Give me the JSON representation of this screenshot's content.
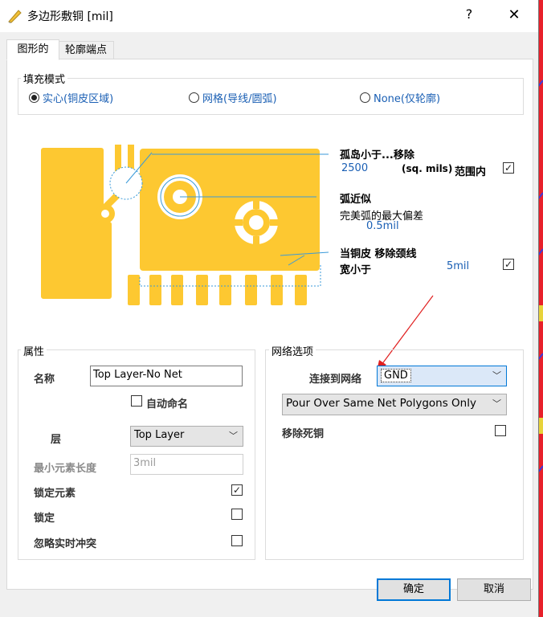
{
  "window": {
    "title": "多边形敷铜 [mil]",
    "help": "?",
    "close": "✕"
  },
  "tabs": [
    {
      "label": "图形的"
    },
    {
      "label": "轮廓端点"
    }
  ],
  "fill_mode": {
    "label": "填充模式",
    "options": [
      {
        "label": "实心(铜皮区域)",
        "selected": true
      },
      {
        "label": "网格(导线/圆弧)",
        "selected": false
      },
      {
        "label": "None(仅轮廓)",
        "selected": false
      }
    ]
  },
  "settings": {
    "island": {
      "label": "孤岛小于...移除",
      "value": "2500",
      "unit": "(sq. mils)",
      "suffix": "范围内",
      "checked": true
    },
    "arc": {
      "label": "弧近似",
      "sub": "完美弧的最大偏差",
      "value": "0.5mil"
    },
    "neck": {
      "label": "当铜皮  移除颈线",
      "label2": "宽小于",
      "value": "5mil",
      "checked": true
    }
  },
  "properties": {
    "label": "属性",
    "name_label": "名称",
    "name_value": "Top Layer-No Net",
    "auto_name_label": "自动命名",
    "auto_name_checked": false,
    "layer_label": "层",
    "layer_value": "Top Layer",
    "min_len_label": "最小元素长度",
    "min_len_placeholder": "3mil",
    "lock_primitives_label": "锁定元素",
    "lock_primitives_checked": true,
    "locked_label": "锁定",
    "locked_checked": false,
    "ignore_violations_label": "忽略实时冲突",
    "ignore_violations_checked": false
  },
  "net_options": {
    "label": "网络选项",
    "connect_label": "连接到网络",
    "connect_value": "GND",
    "pour_value": "Pour Over Same Net Polygons Only",
    "remove_dead_label": "移除死铜",
    "remove_dead_checked": false
  },
  "buttons": {
    "ok": "确定",
    "cancel": "取消"
  },
  "colors": {
    "copper": "#fdc831",
    "accent": "#0078d7",
    "pcb_background": "#e8202a",
    "annotation": "#3a9ad9",
    "arrow": "#e02020"
  }
}
